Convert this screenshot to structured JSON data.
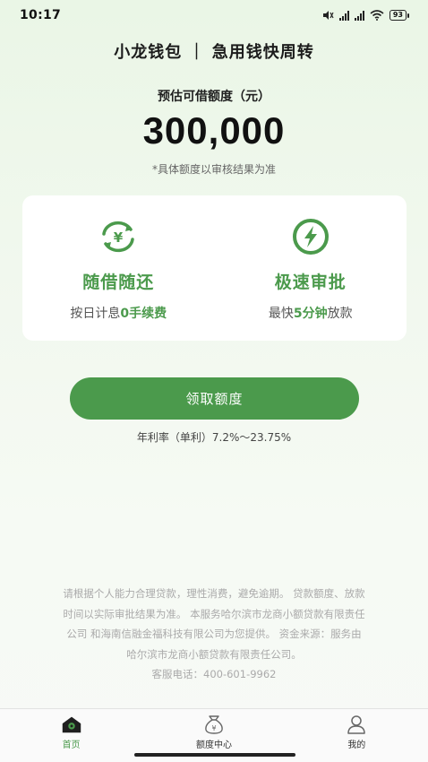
{
  "status": {
    "time": "10:17",
    "battery": "93"
  },
  "header": {
    "title": "小龙钱包 ｜ 急用钱快周转"
  },
  "quota": {
    "label": "预估可借额度（元）",
    "amount": "300,000",
    "note": "*具体额度以审核结果为准"
  },
  "features": [
    {
      "title": "随借随还",
      "desc_prefix": "按日计息",
      "desc_highlight": "0手续费",
      "desc_suffix": "",
      "icon": "yen-cycle-icon"
    },
    {
      "title": "极速审批",
      "desc_prefix": "最快",
      "desc_highlight": "5分钟",
      "desc_suffix": "放款",
      "icon": "lightning-icon"
    }
  ],
  "cta": {
    "label": "领取额度"
  },
  "rate": {
    "text": "年利率（单利）7.2%～23.75%"
  },
  "disclaimer": {
    "lines": [
      "请根据个人能力合理贷款，理性消费，避免逾期。 贷款额度、放款",
      "时间以实际审批结果为准。 本服务哈尔滨市龙商小额贷款有限责任",
      "公司 和海南信融金福科技有限公司为您提供。 资金来源：服务由",
      "哈尔滨市龙商小额贷款有限责任公司。",
      "客服电话：400-601-9962"
    ]
  },
  "tabs": [
    {
      "label": "首页",
      "icon": "home-icon",
      "active": true
    },
    {
      "label": "额度中心",
      "icon": "money-bag-icon",
      "active": false
    },
    {
      "label": "我的",
      "icon": "user-icon",
      "active": false
    }
  ],
  "colors": {
    "brand": "#4b9a4c",
    "text": "#1c1c1c",
    "muted": "#aaaaaa"
  }
}
